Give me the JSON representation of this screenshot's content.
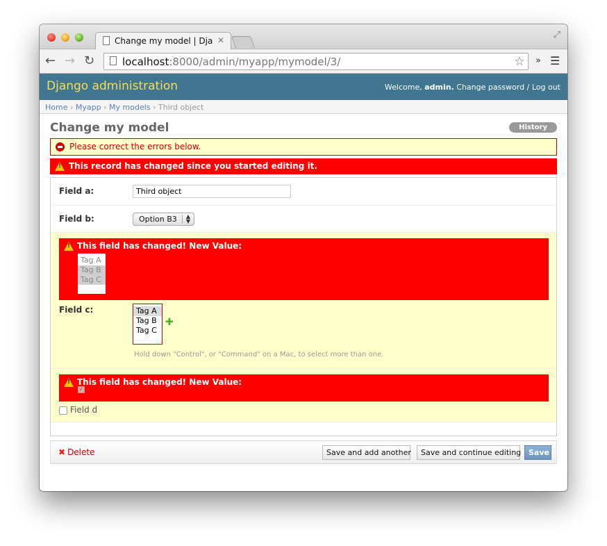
{
  "browser": {
    "tab_title": "Change my model | Djang",
    "tab_close": "✕",
    "url_host": "localhost",
    "url_path": ":8000/admin/myapp/mymodel/3/",
    "icons": [
      "back-icon",
      "forward-icon",
      "reload-icon",
      "page-icon",
      "star-icon",
      "extensions-icon",
      "menu-icon",
      "fullscreen-icon"
    ]
  },
  "header": {
    "brand": "Django administration",
    "welcome": "Welcome,",
    "username": "admin.",
    "change_password": "Change password",
    "separator": "/",
    "logout": "Log out"
  },
  "breadcrumbs": {
    "home": "Home",
    "app": "Myapp",
    "models": "My models",
    "current": "Third object",
    "sep": "›"
  },
  "page": {
    "title": "Change my model",
    "history": "History",
    "errornote": "Please correct the errors below.",
    "changed_note": "This record has changed since you started editing it."
  },
  "form": {
    "field_a": {
      "label": "Field a:",
      "value": "Third object"
    },
    "field_b": {
      "label": "Field b:",
      "value": "Option B3"
    },
    "field_c": {
      "label": "Field c:",
      "changed_msg": "This field has changed! New Value:",
      "new_value_options": [
        {
          "label": "Tag A",
          "selected": false
        },
        {
          "label": "Tag B",
          "selected": true
        },
        {
          "label": "Tag C",
          "selected": true
        }
      ],
      "options": [
        {
          "label": "Tag A",
          "selected": true
        },
        {
          "label": "Tag B",
          "selected": false
        },
        {
          "label": "Tag C",
          "selected": false
        }
      ],
      "help": "Hold down \"Control\", or \"Command\" on a Mac, to select more than one."
    },
    "field_d": {
      "label": "Field d",
      "changed_msg": "This field has changed! New Value:",
      "new_value_checked": true,
      "checked": false
    }
  },
  "submit": {
    "delete": "Delete",
    "save_add": "Save and add another",
    "save_continue": "Save and continue editing",
    "save": "Save"
  },
  "colors": {
    "header_bg": "#417690",
    "brand": "#f5dd5d",
    "error_red": "#ff0000",
    "error_note_bg": "#ffffcc"
  }
}
